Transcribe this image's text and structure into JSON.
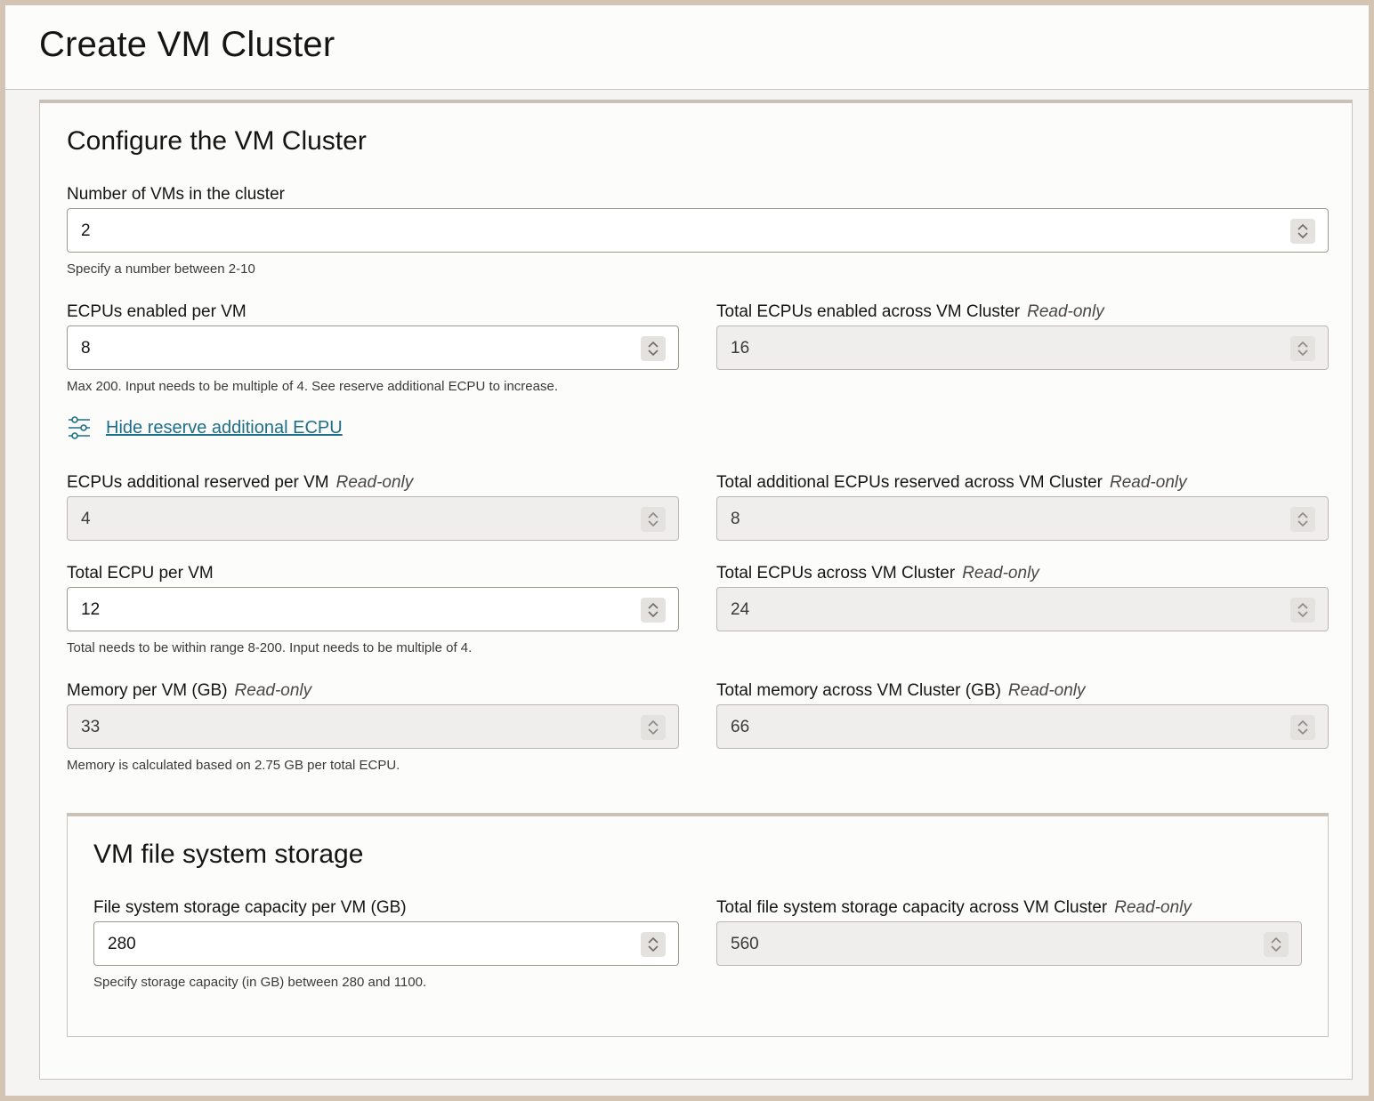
{
  "page": {
    "title": "Create VM Cluster"
  },
  "configure": {
    "title": "Configure the VM Cluster",
    "num_vms": {
      "label": "Number of VMs in the cluster",
      "value": "2",
      "help": "Specify a number between 2-10"
    },
    "ecpus_per_vm": {
      "label": "ECPUs enabled per VM",
      "value": "8",
      "help": "Max 200. Input needs to be multiple of 4. See reserve additional ECPU to increase."
    },
    "total_ecpus_enabled": {
      "label": "Total ECPUs enabled across VM Cluster",
      "readonly": "Read-only",
      "value": "16"
    },
    "reserve_toggle": {
      "label": "Hide reserve additional ECPU",
      "icon": "sliders-icon"
    },
    "additional_reserved_per_vm": {
      "label": "ECPUs additional reserved per VM",
      "readonly": "Read-only",
      "value": "4"
    },
    "total_additional_reserved": {
      "label": "Total additional ECPUs reserved across VM Cluster",
      "readonly": "Read-only",
      "value": "8"
    },
    "total_ecpu_per_vm": {
      "label": "Total ECPU per VM",
      "value": "12",
      "help": "Total needs to be within range 8-200. Input needs to be multiple of 4."
    },
    "total_ecpus_cluster": {
      "label": "Total ECPUs across VM Cluster",
      "readonly": "Read-only",
      "value": "24"
    },
    "memory_per_vm": {
      "label": "Memory per VM (GB)",
      "readonly": "Read-only",
      "value": "33",
      "help": "Memory is calculated based on 2.75 GB per total ECPU."
    },
    "total_memory": {
      "label": "Total memory across VM Cluster (GB)",
      "readonly": "Read-only",
      "value": "66"
    }
  },
  "storage": {
    "title": "VM file system storage",
    "per_vm": {
      "label": "File system storage capacity per VM (GB)",
      "value": "280",
      "help": "Specify storage capacity (in GB) between 280 and 1100."
    },
    "total": {
      "label": "Total file system storage capacity across VM Cluster",
      "readonly": "Read-only",
      "value": "560"
    }
  },
  "colors": {
    "accent_link": "#1d6e8a",
    "readonly_bg": "#efeeed",
    "frame": "#d4c4b4"
  }
}
